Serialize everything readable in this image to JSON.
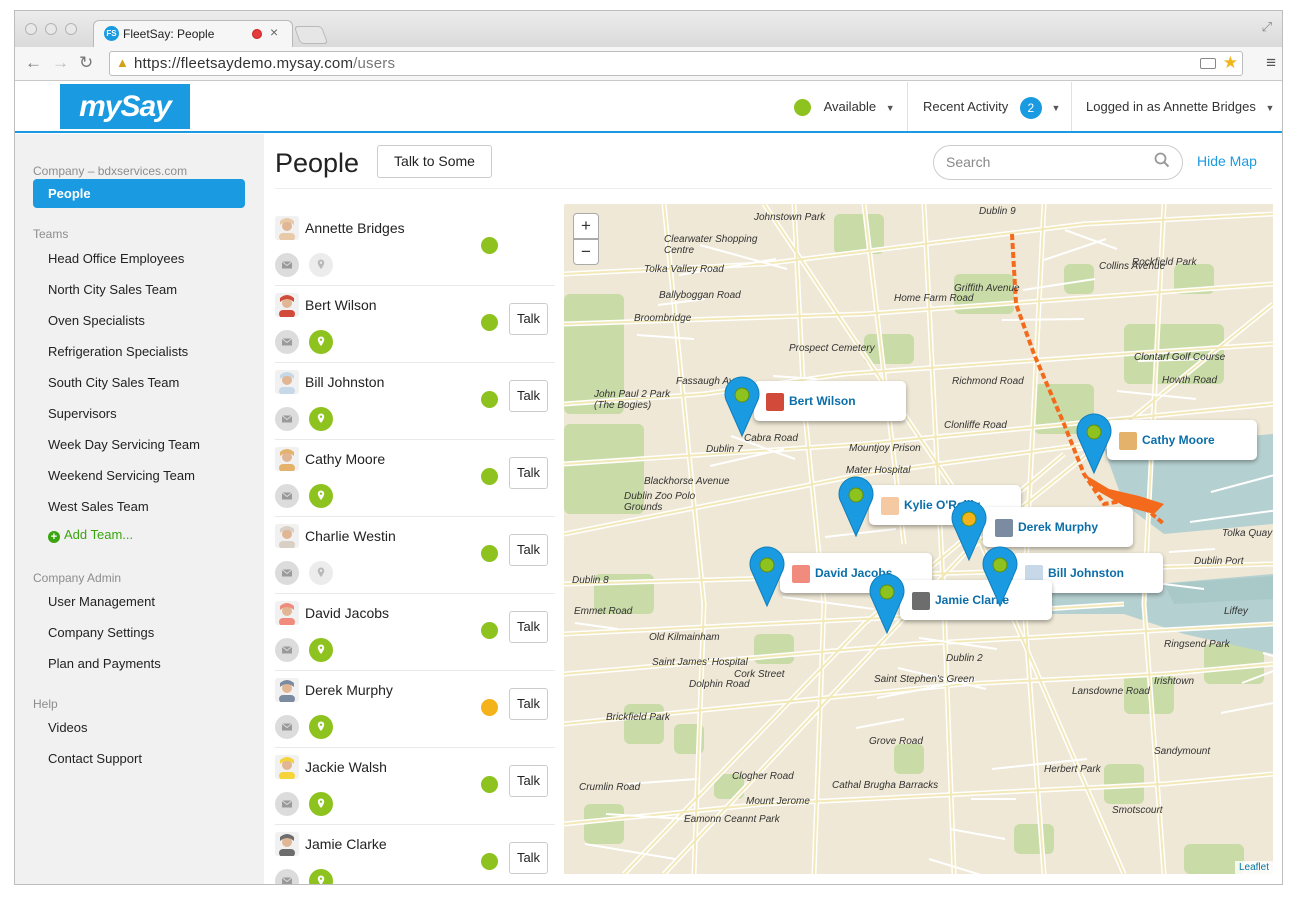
{
  "browser": {
    "tab_title": "FleetSay: People",
    "favicon_text": "FS",
    "url_host": "https://fleetsaydemo.mysay.com",
    "url_path": "/users"
  },
  "header": {
    "logo": "mySay",
    "status_label": "Available",
    "status_color": "#8dc21f",
    "recent_activity_label": "Recent Activity",
    "recent_activity_count": "2",
    "logged_in_label": "Logged in as Annette Bridges"
  },
  "sidebar": {
    "company_label": "Company – bdxservices.com",
    "people_label": "People",
    "teams_label": "Teams",
    "teams": [
      "Head Office Employees",
      "North City Sales Team",
      "Oven Specialists",
      "Refrigeration Specialists",
      "South City Sales Team",
      "Supervisors",
      "Week Day Servicing Team",
      "Weekend Servicing Team",
      "West Sales Team"
    ],
    "add_team_label": "Add Team...",
    "company_admin_label": "Company Admin",
    "admin_items": [
      "User Management",
      "Company Settings",
      "Plan and Payments"
    ],
    "help_label": "Help",
    "help_items": [
      "Videos",
      "Contact Support"
    ]
  },
  "main": {
    "title": "People",
    "talk_to_some_label": "Talk to Some",
    "search_placeholder": "Search",
    "hide_map_label": "Hide Map",
    "talk_label": "Talk"
  },
  "colors": {
    "accent": "#1a9ae0",
    "available": "#8dc21f",
    "busy": "#f4b21b"
  },
  "people": [
    {
      "name": "Annette Bridges",
      "status": "available",
      "location_shared": false,
      "talk": false
    },
    {
      "name": "Bert Wilson",
      "status": "available",
      "location_shared": true,
      "talk": true
    },
    {
      "name": "Bill Johnston",
      "status": "available",
      "location_shared": true,
      "talk": true
    },
    {
      "name": "Cathy Moore",
      "status": "available",
      "location_shared": true,
      "talk": true
    },
    {
      "name": "Charlie Westin",
      "status": "available",
      "location_shared": false,
      "talk": true
    },
    {
      "name": "David Jacobs",
      "status": "available",
      "location_shared": true,
      "talk": true
    },
    {
      "name": "Derek Murphy",
      "status": "busy",
      "location_shared": true,
      "talk": true
    },
    {
      "name": "Jackie Walsh",
      "status": "available",
      "location_shared": true,
      "talk": true
    },
    {
      "name": "Jamie Clarke",
      "status": "available",
      "location_shared": true,
      "talk": true
    }
  ],
  "map": {
    "zoom_in": "+",
    "zoom_out": "−",
    "attribution": "Leaflet",
    "place_labels": [
      "Johnstown Park",
      "Dublin 9",
      "Clearwater Shopping Centre",
      "Tolka Valley Road",
      "Ballyboggan Road",
      "Broombridge",
      "Home Farm Road",
      "Griffith Avenue",
      "Collins Avenue",
      "Rockfield Park",
      "Prospect Cemetery",
      "Fassaugh Ave",
      "John Paul 2 Park (The Bogies)",
      "Cabra Road",
      "Dublin 7",
      "Mountjoy Prison",
      "Clonliffe Road",
      "Richmond Road",
      "Clontarf Golf Course",
      "Howth Road",
      "Mater Hospital",
      "Blackhorse Avenue",
      "Dublin Zoo Polo Grounds",
      "Dublin 8",
      "Dublin 2",
      "Saint Stephen's Green",
      "Saint James' Hospital",
      "Old Kilmainham",
      "Dublin Port",
      "Tolka Quay Road",
      "Liffey",
      "Ringsend Park",
      "Lansdowne Road",
      "Irishtown",
      "Sandymount",
      "Herbert Park",
      "Smotscourt",
      "Grove Road",
      "Cathal Brugha Barracks",
      "Mount Jerome",
      "Eamonn Ceannt Park",
      "Crumlin Road",
      "Brickfield Park",
      "Clogher Road",
      "Dolphin Road",
      "Cork Street",
      "Emmet Road"
    ],
    "pins": [
      {
        "name": "Bert Wilson",
        "status": "available"
      },
      {
        "name": "Cathy Moore",
        "status": "available"
      },
      {
        "name": "Kylie O'Reilly",
        "status": "available"
      },
      {
        "name": "Derek Murphy",
        "status": "busy"
      },
      {
        "name": "David Jacobs",
        "status": "available"
      },
      {
        "name": "Bill Johnston",
        "status": "available"
      },
      {
        "name": "Jamie Clarke",
        "status": "available"
      }
    ]
  }
}
